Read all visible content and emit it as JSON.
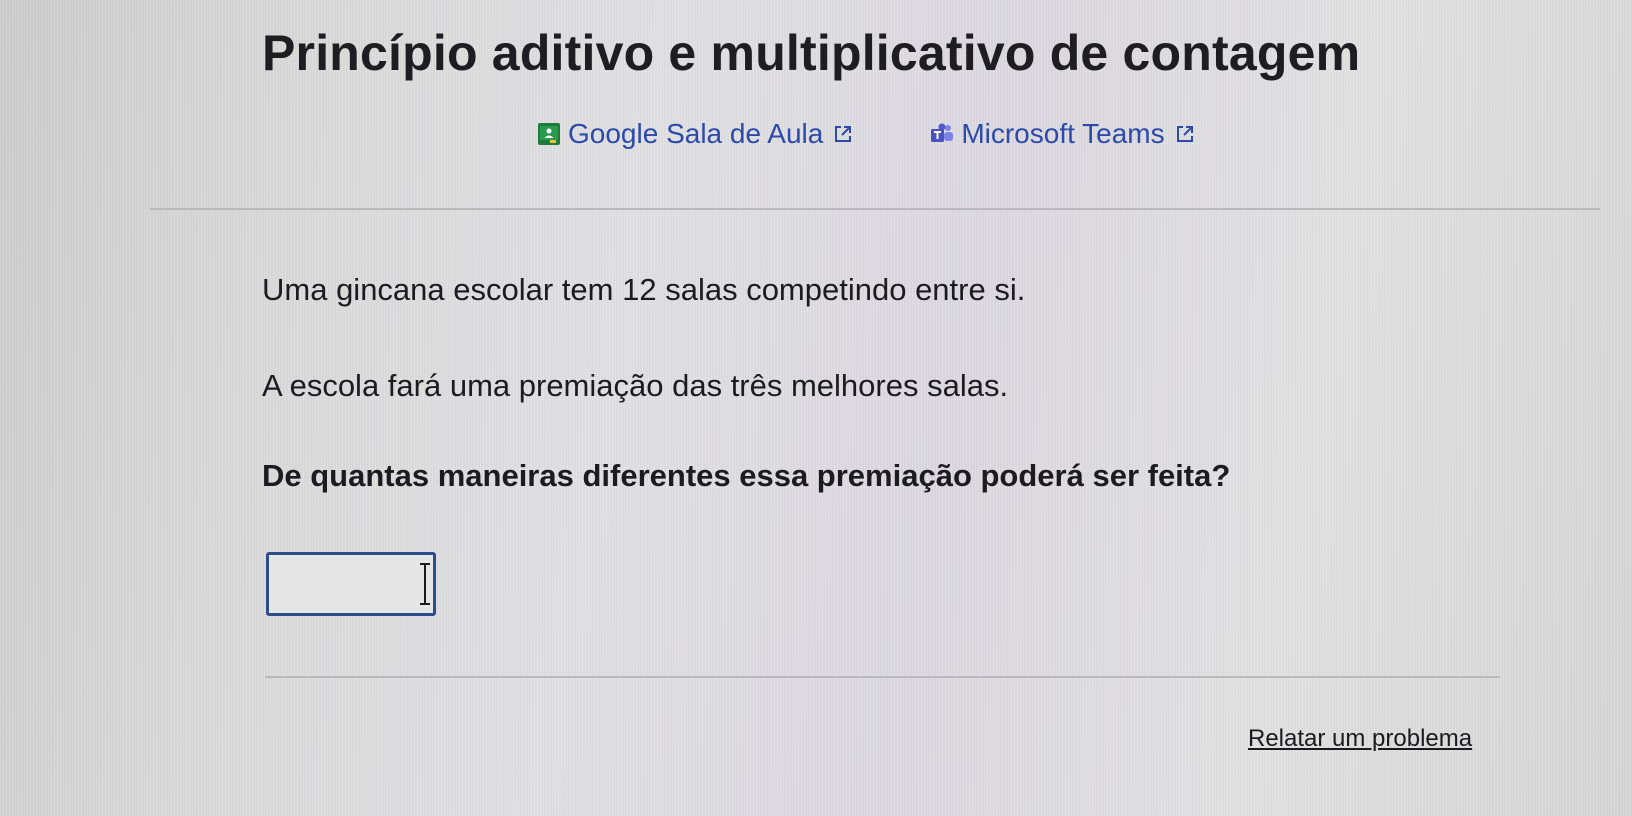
{
  "lesson": {
    "title": "Princípio aditivo e multiplicativo de contagem"
  },
  "share_links": [
    {
      "label": "Google Sala de Aula",
      "icon": "google-classroom-icon",
      "icon_color": "#1e7b3c"
    },
    {
      "label": "Microsoft Teams",
      "icon": "microsoft-teams-icon",
      "icon_color": "#4b53bc"
    }
  ],
  "problem": {
    "paragraph_1_before": "Uma gincana escolar tem ",
    "paragraph_1_number": "12",
    "paragraph_1_after": " salas competindo entre si.",
    "paragraph_2": "A escola fará uma premiação das três melhores salas.",
    "question": "De quantas maneiras diferentes essa premiação poderá ser feita?"
  },
  "answer": {
    "value": ""
  },
  "footer": {
    "report_label": "Relatar um problema"
  },
  "colors": {
    "link": "#2c4aa8",
    "input_border": "#2d4d8c"
  }
}
